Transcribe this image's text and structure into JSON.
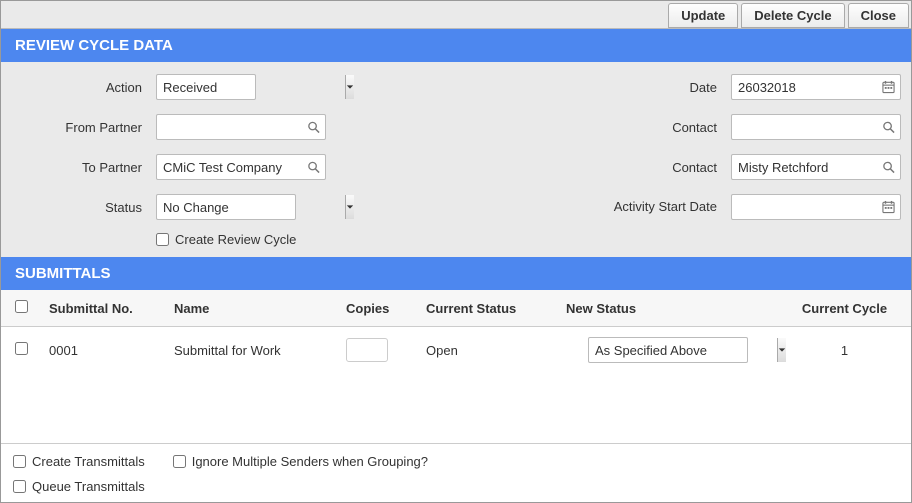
{
  "toolbar": {
    "update": "Update",
    "delete": "Delete Cycle",
    "close": "Close"
  },
  "sections": {
    "review": "REVIEW CYCLE DATA",
    "submittals": "SUBMITTALS"
  },
  "labels": {
    "action": "Action",
    "date": "Date",
    "from_partner": "From Partner",
    "contact1": "Contact",
    "to_partner": "To Partner",
    "contact2": "Contact",
    "status": "Status",
    "activity_start": "Activity Start Date",
    "create_review": "Create Review Cycle"
  },
  "values": {
    "action": "Received",
    "date": "26032018",
    "from_partner": "",
    "contact1": "",
    "to_partner": "CMiC Test Company",
    "contact2": "Misty Retchford",
    "status": "No Change",
    "activity_start": ""
  },
  "table": {
    "headers": {
      "no": "Submittal No.",
      "name": "Name",
      "copies": "Copies",
      "current": "Current Status",
      "newstat": "New Status",
      "cycle": "Current Cycle"
    },
    "rows": [
      {
        "no": "0001",
        "name": "Submittal for Work",
        "copies": "",
        "current": "Open",
        "newstat": "As Specified Above",
        "cycle": "1"
      }
    ]
  },
  "options": {
    "create_trans": "Create Transmittals",
    "ignore_multi": "Ignore Multiple Senders when Grouping?",
    "queue_trans": "Queue Transmittals"
  }
}
